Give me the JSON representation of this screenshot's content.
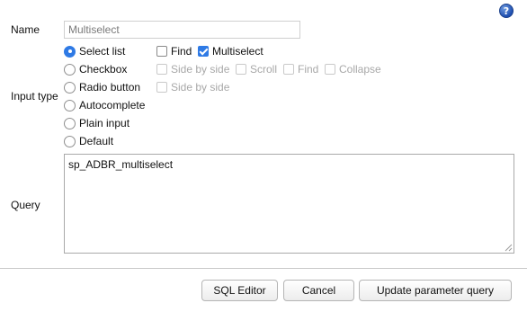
{
  "help": {
    "glyph": "?"
  },
  "form": {
    "name_label": "Name",
    "name_value": "Multiselect",
    "input_type_label": "Input type",
    "query_label": "Query",
    "query_value": "sp_ADBR_multiselect"
  },
  "input_types": [
    {
      "label": "Select list",
      "checked": true
    },
    {
      "label": "Checkbox",
      "checked": false
    },
    {
      "label": "Radio button",
      "checked": false
    },
    {
      "label": "Autocomplete",
      "checked": false
    },
    {
      "label": "Plain input",
      "checked": false
    },
    {
      "label": "Default",
      "checked": false
    }
  ],
  "options": {
    "select_list": [
      {
        "label": "Find",
        "checked": false,
        "enabled": true
      },
      {
        "label": "Multiselect",
        "checked": true,
        "enabled": true
      }
    ],
    "checkbox": [
      {
        "label": "Side by side",
        "checked": false,
        "enabled": false
      },
      {
        "label": "Scroll",
        "checked": false,
        "enabled": false
      },
      {
        "label": "Find",
        "checked": false,
        "enabled": false
      },
      {
        "label": "Collapse",
        "checked": false,
        "enabled": false
      }
    ],
    "radio_button": [
      {
        "label": "Side by side",
        "checked": false,
        "enabled": false
      }
    ]
  },
  "buttons": {
    "sql_editor": "SQL Editor",
    "cancel": "Cancel",
    "update": "Update parameter query"
  },
  "colors": {
    "accent": "#2f7ae5",
    "disabled_text": "#a8a8a8"
  }
}
